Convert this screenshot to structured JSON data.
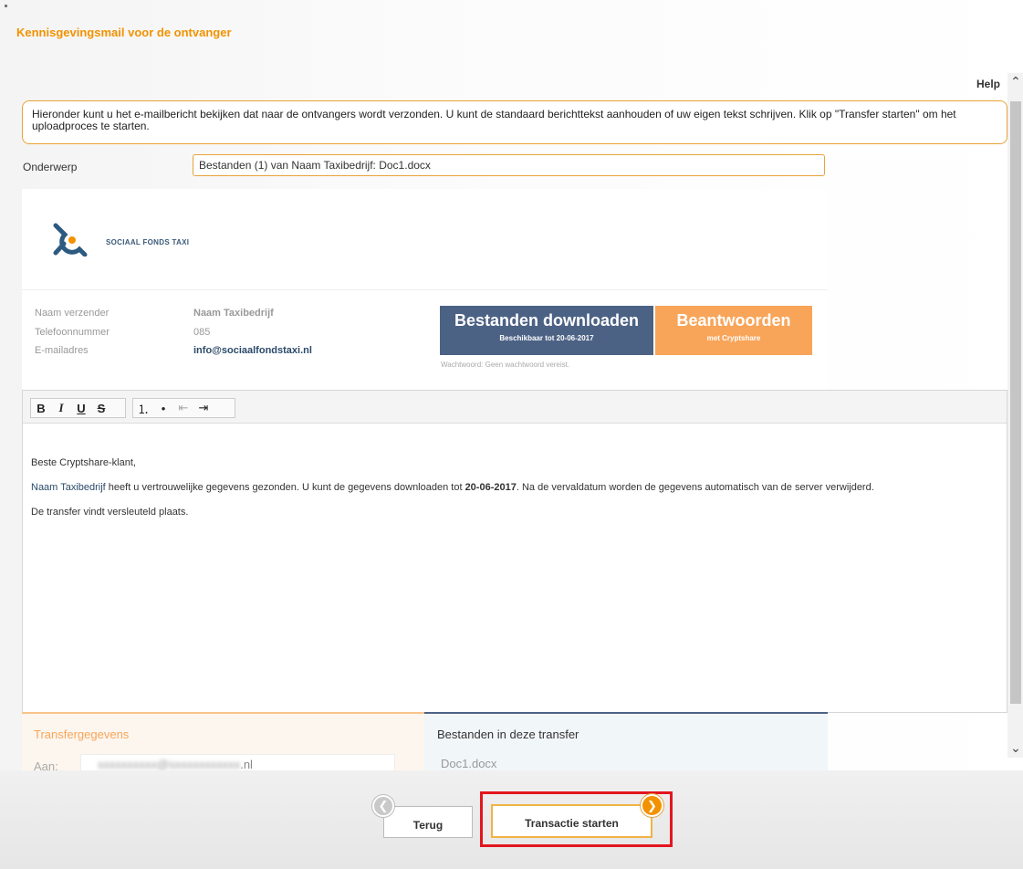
{
  "header": {
    "title": "Kennisgevingsmail voor de ontvanger",
    "help_label": "Help"
  },
  "info": {
    "text": "Hieronder kunt u het e-mailbericht bekijken dat naar de ontvangers wordt verzonden. U kunt de standaard berichttekst aanhouden of uw eigen tekst schrijven. Klik op \"Transfer starten\" om het uploadproces te starten."
  },
  "subject": {
    "label": "Onderwerp",
    "value": "Bestanden (1) van Naam Taxibedrijf: Doc1.docx"
  },
  "preview": {
    "logo_text": "SOCIAAL FONDS TAXI",
    "fields": [
      {
        "label": "Naam verzender",
        "value": "Naam Taxibedrijf"
      },
      {
        "label": "Telefoonnummer",
        "value": "085"
      },
      {
        "label": "E-mailadres",
        "value": "info@sociaalfondstaxi.nl"
      }
    ],
    "download_button": {
      "title": "Bestanden downloaden",
      "subtitle": "Beschikbaar tot 20-06-2017"
    },
    "reply_button": {
      "title": "Beantwoorden",
      "subtitle": "met Cryptshare"
    },
    "password_note": "Wachtwoord: Geen wachtwoord vereist."
  },
  "editor": {
    "toolbar": {
      "bold": "B",
      "italic": "I",
      "underline": "U",
      "strike": "S",
      "ordered_list": "⒈",
      "bullet_list": "•",
      "outdent": "⇤",
      "indent": "⇥"
    },
    "greeting": "Beste Cryptshare-klant,",
    "sender_name": "Naam Taxibedrijf",
    "body_part1": " heeft u vertrouwelijke gegevens gezonden. U kunt de gegevens downloaden tot ",
    "body_date": "20-06-2017",
    "body_part2": ". Na de vervaldatum worden de gegevens automatisch van de server verwijderd.",
    "closing": "De transfer vindt versleuteld plaats."
  },
  "transfer": {
    "title": "Transfergegevens",
    "to_label": "Aan:",
    "to_value_hidden": "xxxxxxxxxx@sxxxxxxxxxxx",
    "to_value_suffix": ".nl"
  },
  "files": {
    "title": "Bestanden in deze transfer",
    "items": [
      "Doc1.docx"
    ]
  },
  "footer": {
    "back_label": "Terug",
    "start_label": "Transactie starten"
  },
  "colors": {
    "accent": "#f39200",
    "navy": "#4c6285",
    "orange_button": "#f8a55a",
    "highlight": "#e3161e"
  }
}
